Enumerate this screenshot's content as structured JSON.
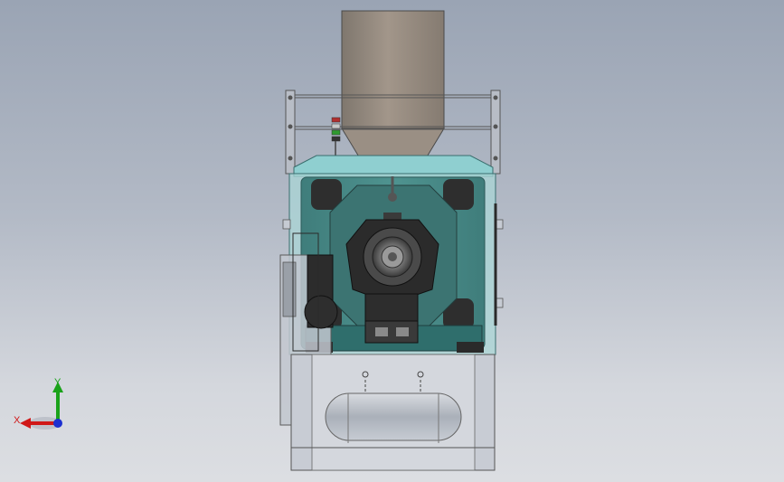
{
  "view": {
    "axes": {
      "x_label": "X",
      "y_label": "Y"
    },
    "colors": {
      "axis_x": "#d01818",
      "axis_y": "#1aa21a",
      "axis_z": "#1c2fd0",
      "hopper": "#8f857a",
      "frame_teal": "#4f8f8c",
      "frame_glass": "#8fcfd0",
      "rotor": "#3a3a3a"
    },
    "icons": {
      "triad": "coordinate-triad-icon"
    }
  }
}
